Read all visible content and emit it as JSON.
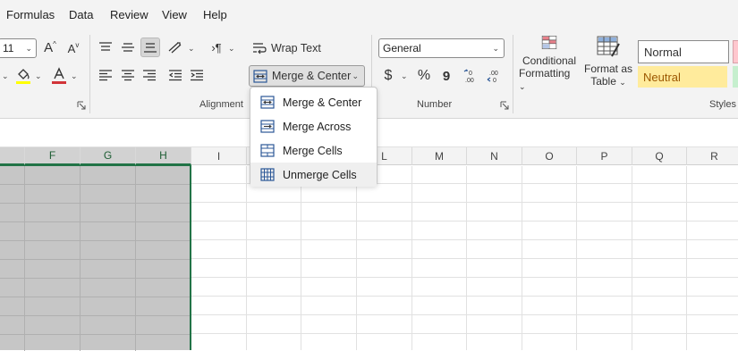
{
  "menu": [
    "Formulas",
    "Data",
    "Review",
    "View",
    "Help"
  ],
  "font": {
    "size": "11",
    "grow_label": "A",
    "shrink_label": "A"
  },
  "alignment": {
    "wrap_text": "Wrap Text",
    "merge_center": "Merge & Center",
    "group_label": "Alignment"
  },
  "number": {
    "format": "General",
    "currency_symbol": "$",
    "percent_symbol": "%",
    "comma_symbol": "9",
    "group_label": "Number"
  },
  "styles": {
    "conditional_formatting": [
      "Conditional",
      "Formatting"
    ],
    "format_as_table": [
      "Format as",
      "Table"
    ],
    "normal": "Normal",
    "neutral": "Neutral",
    "group_label": "Styles"
  },
  "colors": {
    "accent_green": "#217346",
    "neutral_fill": "#ffeb9c",
    "neutral_text": "#9c5700",
    "font_color": "#d13438",
    "highlight": "#ffff00"
  },
  "columns": [
    "F",
    "G",
    "H",
    "I",
    "J",
    "K",
    "L",
    "M",
    "N",
    "O",
    "P",
    "Q",
    "R"
  ],
  "dropdown": {
    "items": [
      {
        "label": "Merge & Center"
      },
      {
        "label": "Merge Across"
      },
      {
        "label": "Merge Cells"
      },
      {
        "label": "Unmerge Cells"
      }
    ]
  }
}
